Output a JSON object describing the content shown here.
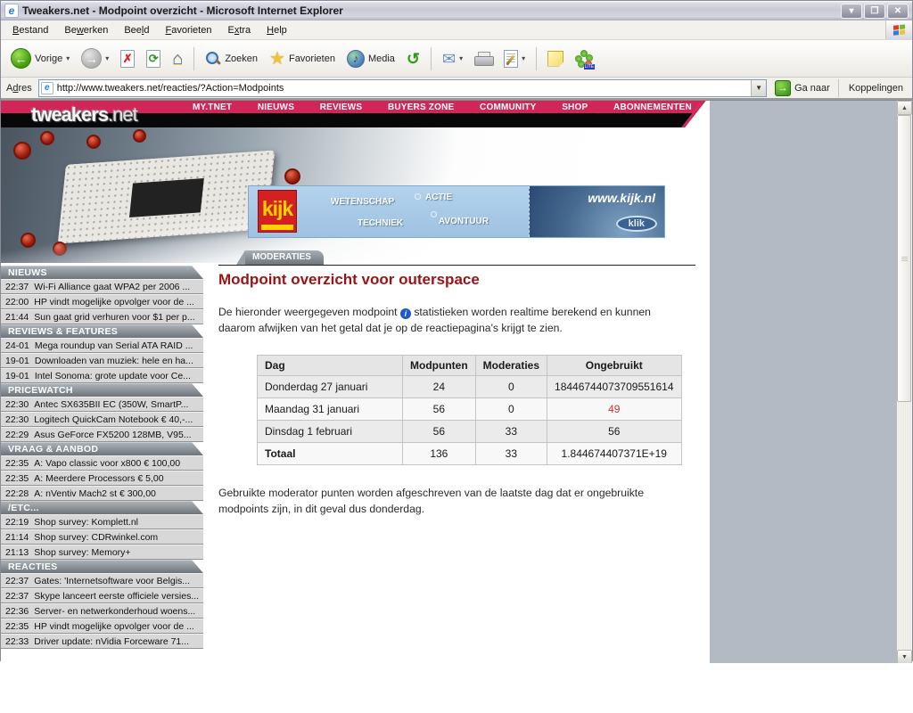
{
  "window": {
    "title": "Tweakers.net - Modpoint overzicht - Microsoft Internet Explorer"
  },
  "menu": {
    "items": [
      {
        "pre": "",
        "u": "B",
        "post": "estand"
      },
      {
        "pre": "Be",
        "u": "w",
        "post": "erken"
      },
      {
        "pre": "Bee",
        "u": "l",
        "post": "d"
      },
      {
        "pre": "",
        "u": "F",
        "post": "avorieten"
      },
      {
        "pre": "E",
        "u": "x",
        "post": "tra"
      },
      {
        "pre": "",
        "u": "H",
        "post": "elp"
      }
    ]
  },
  "toolbar": {
    "back_label": "Vorige",
    "search_label": "Zoeken",
    "favorites_label": "Favorieten",
    "media_label": "Media"
  },
  "addressbar": {
    "label_pre": "A",
    "label_u": "d",
    "label_post": "res",
    "url": "http://www.tweakers.net/reacties/?Action=Modpoints",
    "go_label": "Ga naar",
    "links_label": "Koppelingen"
  },
  "site": {
    "logo": {
      "main": "tweakers",
      "suffix": ".net"
    },
    "nav": [
      {
        "label": "MY.TNET"
      },
      {
        "label": "NIEUWS"
      },
      {
        "label": "REVIEWS"
      },
      {
        "label": "BUYERS ZONE"
      },
      {
        "label": "COMMUNITY"
      },
      {
        "label": "SHOP"
      },
      {
        "label": "ABONNEMENTEN"
      }
    ],
    "tab_label": "MODERATIES"
  },
  "banner": {
    "brand": "kijk",
    "cat1": "WETENSCHAP",
    "cat2": "TECHNIEK",
    "cat3": "ACTIE",
    "cat4": "AVONTUUR",
    "url": "www.kijk.nl",
    "button": "klik"
  },
  "main": {
    "heading": "Modpoint overzicht voor outerspace",
    "intro_before": "De hieronder weergegeven modpoint",
    "intro_after": "statistieken worden realtime berekend en kunnen daarom afwijken van het getal dat je op de reactiepagina's krijgt te zien.",
    "note": "Gebruikte moderator punten worden afgeschreven van de laatste dag dat er ongebruikte modpoints zijn, in dit geval dus donderdag.",
    "table": {
      "headers": [
        {
          "label": "Dag",
          "cls": "col-dag"
        },
        {
          "label": "Modpunten",
          "cls": "col-num"
        },
        {
          "label": "Moderaties",
          "cls": "col-num"
        },
        {
          "label": "Ongebruikt",
          "cls": "col-ong"
        }
      ],
      "rows": [
        {
          "dag": "Donderdag 27 januari",
          "modpunten": "24",
          "moderaties": "0",
          "ongebruikt": "18446744073709551614"
        },
        {
          "dag": "Maandag 31 januari",
          "modpunten": "56",
          "moderaties": "0",
          "ongebruikt": "49",
          "ongebruikt_class": "red"
        },
        {
          "dag": "Dinsdag 1 februari",
          "modpunten": "56",
          "moderaties": "33",
          "ongebruikt": "56"
        },
        {
          "dag": "Totaal",
          "modpunten": "136",
          "moderaties": "33",
          "ongebruikt": "1.844674407371E+19",
          "row_class": "total"
        }
      ]
    }
  },
  "sidebar": {
    "sections": [
      {
        "header": "NIEUWS",
        "items": [
          {
            "time": "22:37",
            "text": "Wi-Fi Alliance gaat WPA2 per 2006 ..."
          },
          {
            "time": "22:00",
            "text": "HP vindt mogelijke opvolger voor de ..."
          },
          {
            "time": "21:44",
            "text": "Sun gaat grid verhuren voor $1 per p..."
          }
        ]
      },
      {
        "header": "REVIEWS & FEATURES",
        "items": [
          {
            "time": "24-01",
            "text": "Mega roundup van Serial ATA RAID ..."
          },
          {
            "time": "19-01",
            "text": "Downloaden van muziek: hele en ha..."
          },
          {
            "time": "19-01",
            "text": "Intel Sonoma: grote update voor Ce..."
          }
        ]
      },
      {
        "header": "PRICEWATCH",
        "items": [
          {
            "time": "22:30",
            "text": "Antec SX635BII EC (350W, SmartP..."
          },
          {
            "time": "22:30",
            "text": "Logitech QuickCam Notebook € 40,-..."
          },
          {
            "time": "22:29",
            "text": "Asus GeForce FX5200 128MB, V95..."
          }
        ]
      },
      {
        "header": "VRAAG & AANBOD",
        "items": [
          {
            "time": "22:35",
            "text": "A: Vapo classic voor x800 € 100,00"
          },
          {
            "time": "22:35",
            "text": "A: Meerdere Processors € 5,00"
          },
          {
            "time": "22:28",
            "text": "A: nVentiv Mach2 st € 300,00"
          }
        ]
      },
      {
        "header": "/ETC...",
        "items": [
          {
            "time": "22:19",
            "text": "Shop survey: Komplett.nl"
          },
          {
            "time": "21:14",
            "text": "Shop survey: CDRwinkel.com"
          },
          {
            "time": "21:13",
            "text": "Shop survey: Memory+"
          }
        ]
      },
      {
        "header": "REACTIES",
        "items": [
          {
            "time": "22:37",
            "text": "Gates: 'Internetsoftware voor Belgis..."
          },
          {
            "time": "22:37",
            "text": "Skype lanceert eerste officiele versies..."
          },
          {
            "time": "22:36",
            "text": "Server- en netwerkonderhoud woens..."
          },
          {
            "time": "22:35",
            "text": "HP vindt mogelijke opvolger voor de ..."
          },
          {
            "time": "22:33",
            "text": "Driver update: nVidia Forceware 71..."
          }
        ]
      }
    ]
  },
  "colors": {
    "accent_pink": "#d22558",
    "heading_red": "#991414",
    "value_red": "#cc3333",
    "info_blue": "#1f58c8",
    "desktop_gray": "#b3bac3"
  }
}
